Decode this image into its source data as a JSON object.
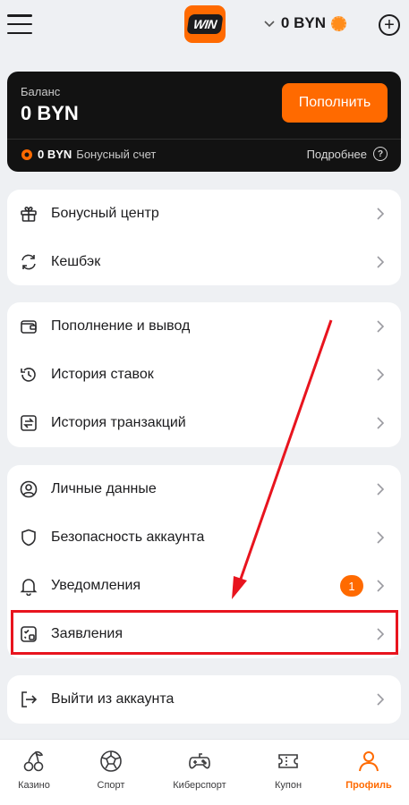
{
  "header": {
    "logo_text": "WIN",
    "balance": "0 BYN"
  },
  "balance_card": {
    "label": "Баланс",
    "amount": "0 BYN",
    "deposit_button": "Пополнить",
    "bonus_amount": "0 BYN",
    "bonus_label": "Бонусный счет",
    "details_link": "Подробнее"
  },
  "groups": [
    {
      "items": [
        {
          "label": "Бонусный центр",
          "icon": "gift-icon"
        },
        {
          "label": "Кешбэк",
          "icon": "refresh-icon"
        }
      ]
    },
    {
      "items": [
        {
          "label": "Пополнение и вывод",
          "icon": "wallet-icon"
        },
        {
          "label": "История ставок",
          "icon": "history-icon"
        },
        {
          "label": "История транзакций",
          "icon": "transfer-icon"
        }
      ]
    },
    {
      "items": [
        {
          "label": "Личные данные",
          "icon": "user-icon"
        },
        {
          "label": "Безопасность аккаунта",
          "icon": "shield-icon"
        },
        {
          "label": "Уведомления",
          "icon": "bell-icon",
          "badge": "1"
        },
        {
          "label": "Заявления",
          "icon": "document-icon"
        }
      ]
    },
    {
      "items": [
        {
          "label": "Выйти из аккаунта",
          "icon": "logout-icon"
        }
      ]
    }
  ],
  "bottom_nav": [
    {
      "label": "Казино",
      "icon": "cherry-icon"
    },
    {
      "label": "Спорт",
      "icon": "ball-icon"
    },
    {
      "label": "Киберспорт",
      "icon": "gamepad-icon"
    },
    {
      "label": "Купон",
      "icon": "ticket-icon"
    },
    {
      "label": "Профиль",
      "icon": "profile-icon",
      "active": true
    }
  ],
  "colors": {
    "accent": "#ff6a00",
    "highlight": "#e8141e",
    "background": "#eef0f3"
  }
}
